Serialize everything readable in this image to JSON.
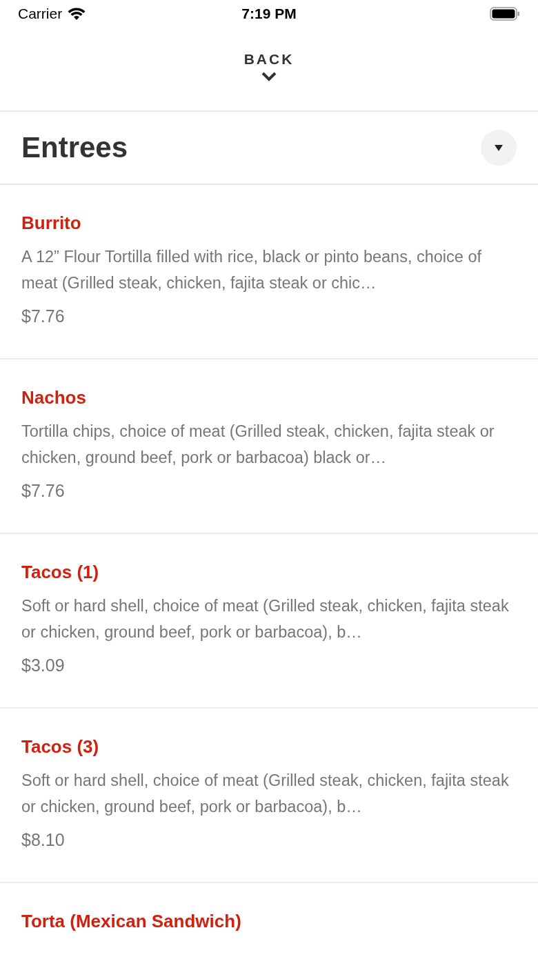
{
  "status_bar": {
    "carrier": "Carrier",
    "time": "7:19 PM"
  },
  "back": {
    "label": "BACK"
  },
  "section": {
    "title": "Entrees"
  },
  "items": [
    {
      "name": "Burrito",
      "description": "A 12” Flour Tortilla filled with rice, black or pinto beans, choice of meat (Grilled steak, chicken, fajita steak or chic…",
      "price": "$7.76"
    },
    {
      "name": "Nachos",
      "description": "Tortilla chips, choice of meat (Grilled steak, chicken, fajita steak or chicken, ground beef, pork or barbacoa) black or…",
      "price": "$7.76"
    },
    {
      "name": "Tacos (1)",
      "description": "Soft or hard shell, choice of meat (Grilled steak, chicken, fajita steak or chicken, ground beef, pork or barbacoa), b…",
      "price": "$3.09"
    },
    {
      "name": "Tacos (3)",
      "description": "Soft or hard shell, choice of meat (Grilled steak, chicken, fajita steak or chicken, ground beef, pork or barbacoa), b…",
      "price": "$8.10"
    },
    {
      "name": "Torta (Mexican Sandwich)"
    }
  ]
}
